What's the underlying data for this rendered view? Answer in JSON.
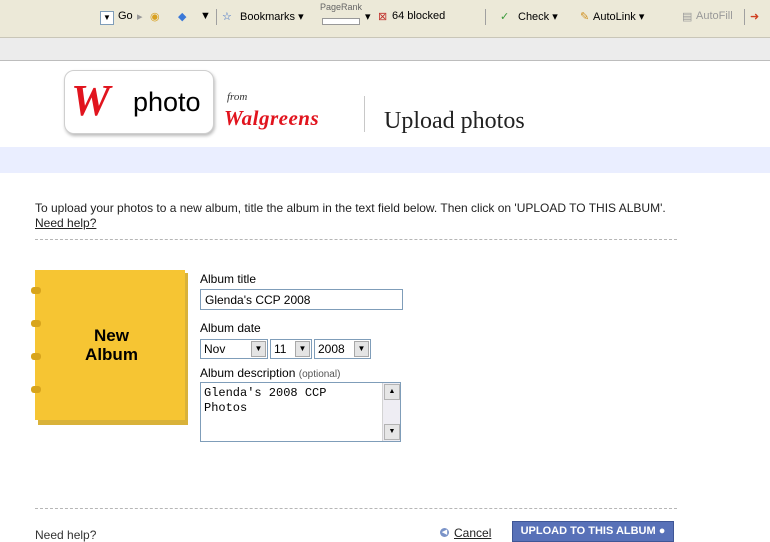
{
  "toolbar": {
    "go": "Go",
    "bookmarks": "Bookmarks",
    "pagerank": "PageRank",
    "blocked": "64 blocked",
    "check": "Check",
    "autolink": "AutoLink",
    "autofill": "AutoFill"
  },
  "header": {
    "logo_letter": "W",
    "logo_word": "photo",
    "from": "from",
    "brand": "Walgreens",
    "title": "Upload photos"
  },
  "intro": {
    "text": "To upload your photos to a new album, title the album in the text field below. Then click on 'UPLOAD TO THIS ALBUM'.",
    "help": "Need help?"
  },
  "album": {
    "cover_line1": "New",
    "cover_line2": "Album"
  },
  "form": {
    "title_label": "Album title",
    "title_value": "Glenda's CCP 2008",
    "date_label": "Album date",
    "month": "Nov",
    "day": "11",
    "year": "2008",
    "desc_label": "Album description",
    "desc_optional": "(optional)",
    "desc_value": "Glenda's 2008 CCP Photos"
  },
  "footer": {
    "help": "Need help?",
    "cancel": "Cancel",
    "upload": "UPLOAD TO THIS ALBUM"
  },
  "colors": {
    "brand_red": "#e1141e",
    "cover_yellow": "#f6c533",
    "button_blue": "#5871b8"
  }
}
